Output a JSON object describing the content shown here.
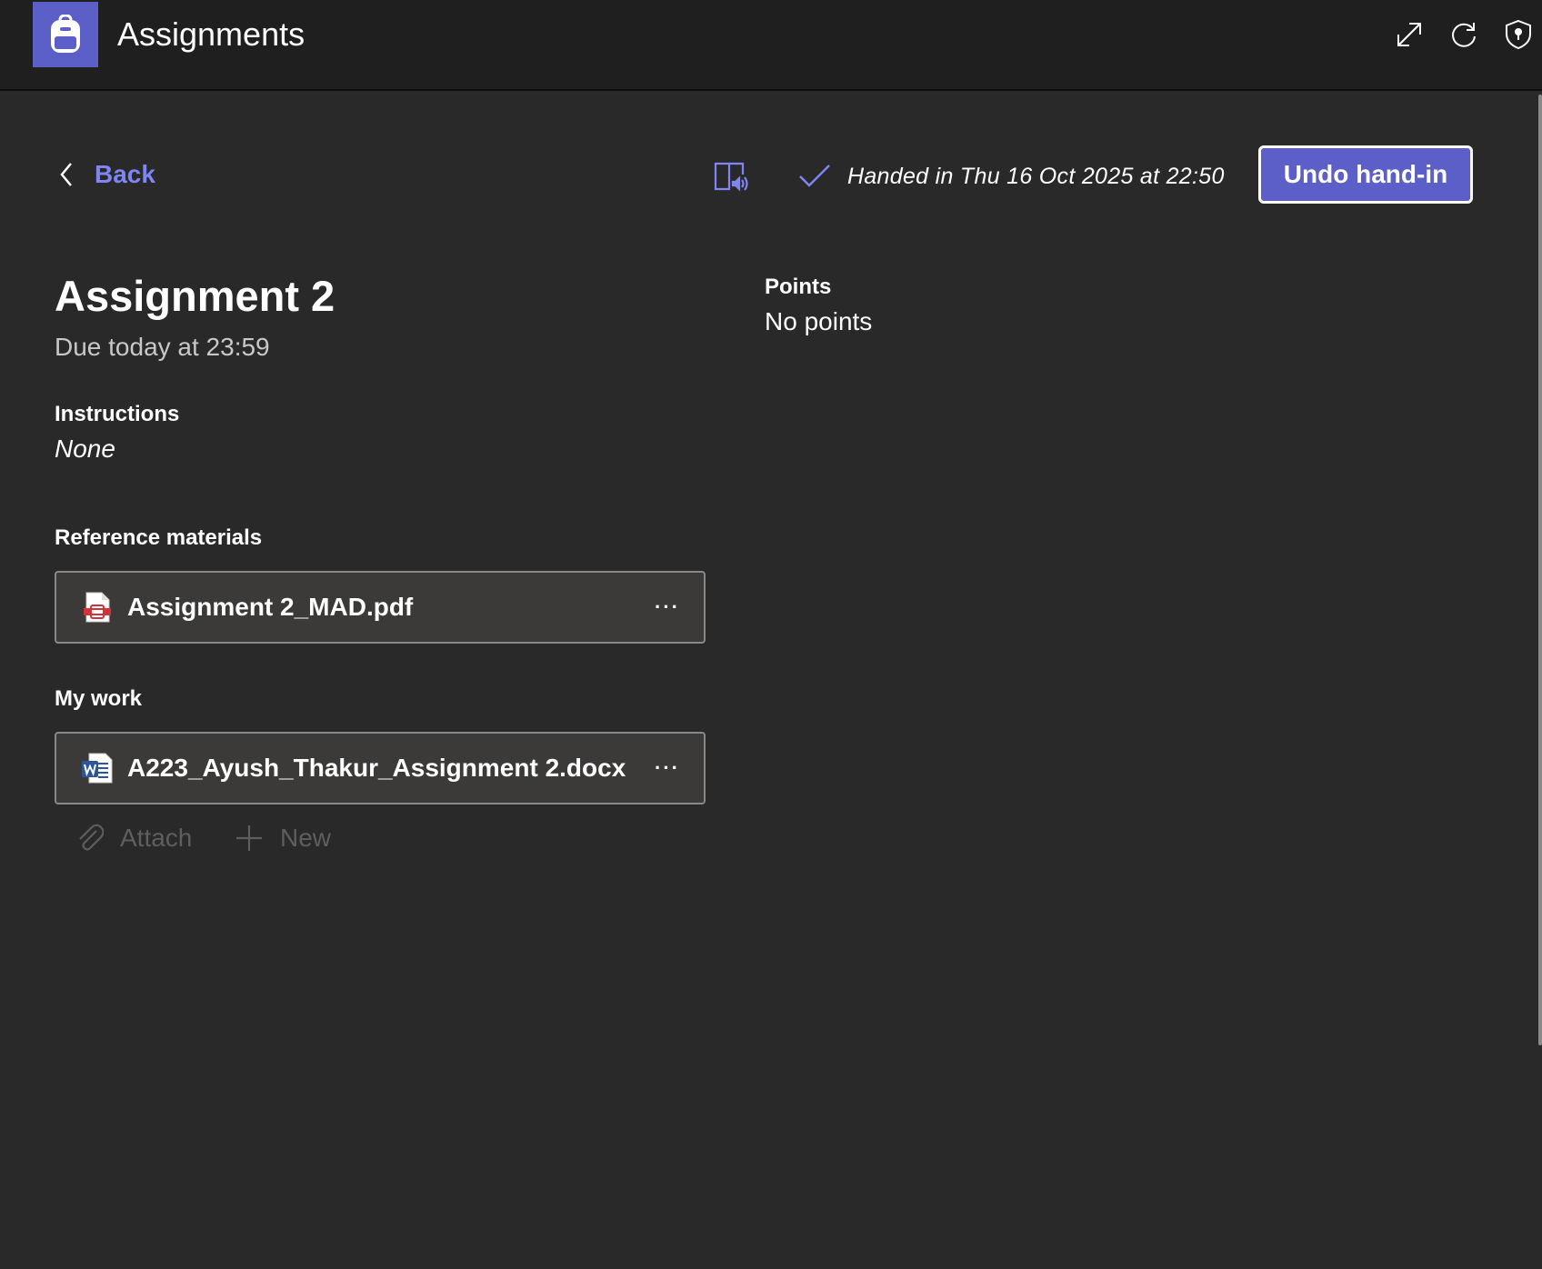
{
  "header": {
    "title": "Assignments",
    "accent_color": "#5b5fc7",
    "icons": [
      "backpack-icon",
      "expand-icon",
      "refresh-icon",
      "shield-icon"
    ]
  },
  "toolbar": {
    "back_label": "Back",
    "status_text": "Handed in Thu 16 Oct 2025 at 22:50",
    "undo_label": "Undo hand-in"
  },
  "assignment": {
    "title": "Assignment 2",
    "due": "Due today at 23:59",
    "instructions_label": "Instructions",
    "instructions_value": "None",
    "points_label": "Points",
    "points_value": "No points"
  },
  "reference_materials": {
    "label": "Reference materials",
    "files": [
      {
        "name": "Assignment 2_MAD.pdf",
        "icon": "pdf-file-icon"
      }
    ]
  },
  "my_work": {
    "label": "My work",
    "files": [
      {
        "name": "A223_Ayush_Thakur_Assignment 2.docx",
        "icon": "word-file-icon"
      }
    ],
    "attach_label": "Attach",
    "new_label": "New"
  },
  "more_label": "···"
}
